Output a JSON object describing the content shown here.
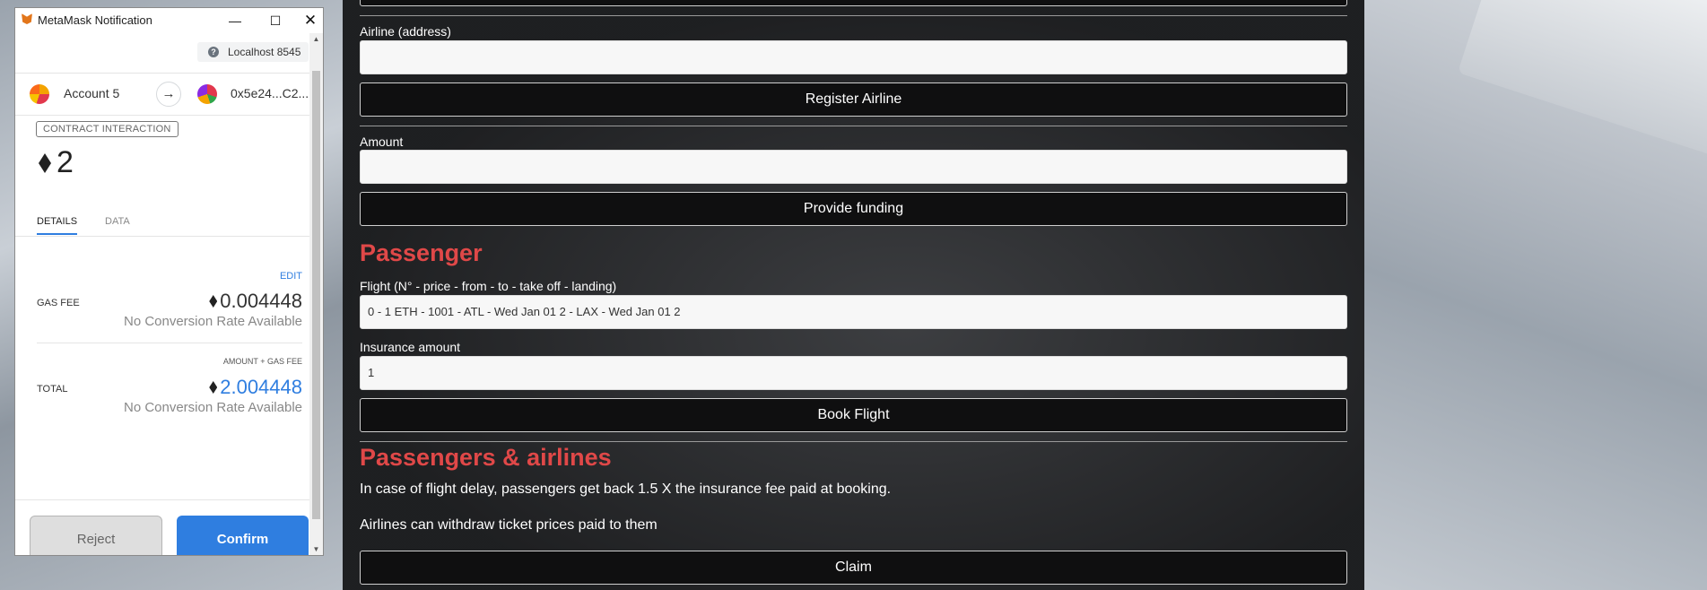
{
  "dapp": {
    "airline_address_label": "Airline (address)",
    "airline_address_value": "",
    "register_airline_button": "Register Airline",
    "amount_label": "Amount",
    "amount_value": "",
    "provide_funding_button": "Provide funding",
    "passenger_heading": "Passenger",
    "flight_label": "Flight (N° - price - from - to - take off - landing)",
    "flight_value": "0 - 1 ETH - 1001 - ATL - Wed Jan 01 2 - LAX - Wed Jan 01 2",
    "insurance_label": "Insurance amount",
    "insurance_value": "1",
    "book_flight_button": "Book Flight",
    "passengers_airlines_heading": "Passengers & airlines",
    "delay_text": "In case of flight delay, passengers get back 1.5 X the insurance fee paid at booking.",
    "withdraw_text": "Airlines can withdraw ticket prices paid to them",
    "claim_button": "Claim"
  },
  "metamask": {
    "window_title": "MetaMask Notification",
    "network": "Localhost 8545",
    "account_name": "Account 5",
    "to_address": "0x5e24...C2...",
    "badge": "CONTRACT INTERACTION",
    "amount": "2",
    "tabs": [
      "DETAILS",
      "DATA"
    ],
    "edit": "EDIT",
    "gas_fee_label": "GAS FEE",
    "gas_fee_value": "0.004448",
    "gas_fee_sub": "No Conversion Rate Available",
    "amount_gas_caption": "AMOUNT + GAS FEE",
    "total_label": "TOTAL",
    "total_value": "2.004448",
    "total_sub": "No Conversion Rate Available",
    "reject": "Reject",
    "confirm": "Confirm",
    "colors": {
      "accent": "#2f7ee0",
      "heading_red": "#e04848"
    }
  }
}
